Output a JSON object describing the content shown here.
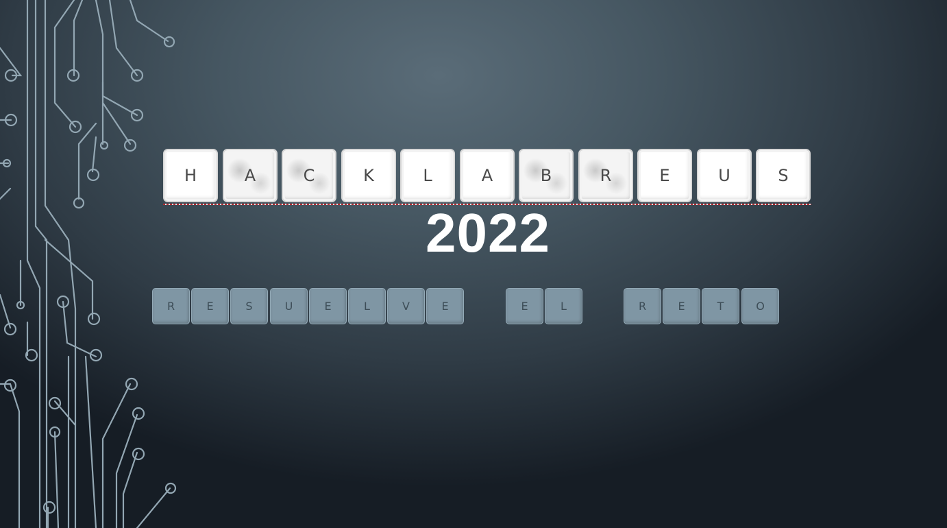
{
  "slide": {
    "title_keys": [
      "H",
      "A",
      "C",
      "K",
      "L",
      "A",
      "B",
      "R",
      "E",
      "U",
      "S"
    ],
    "year": "2022",
    "subtitle_words": [
      [
        "R",
        "E",
        "S",
        "U",
        "E",
        "L",
        "V",
        "E"
      ],
      [
        "E",
        "L"
      ],
      [
        "R",
        "E",
        "T",
        "O"
      ]
    ]
  },
  "decoration": {
    "circuit_graphic": "circuit-lines-icon",
    "colors": {
      "background_light": "#5a6c78",
      "background_dark": "#161d25",
      "circuit_lines": "#93a7b3",
      "title_key_face": "#ffffff",
      "subtitle_key_face": "#7f96a4",
      "year_text": "#ffffff"
    }
  }
}
